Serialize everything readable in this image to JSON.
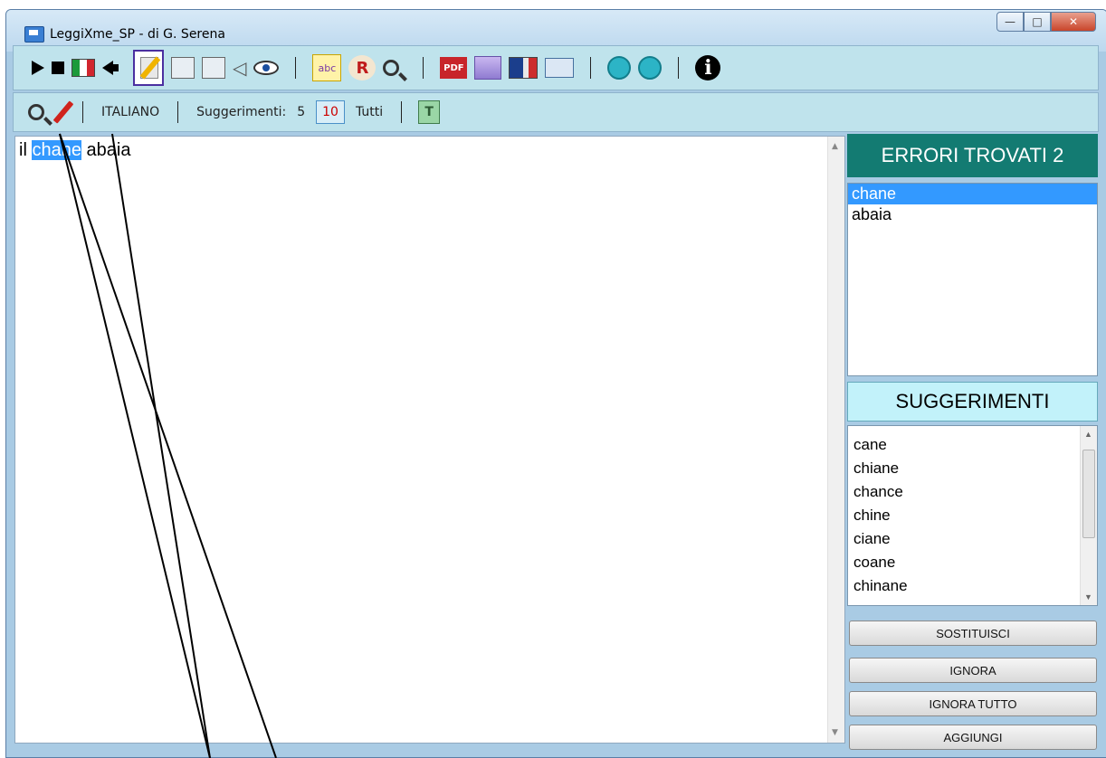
{
  "window": {
    "title": "LeggiXme_SP - di G. Serena"
  },
  "toolbar2": {
    "language": "ITALIANO",
    "suggestions_label": "Suggerimenti:",
    "opt_5": "5",
    "opt_10": "10",
    "opt_all": "Tutti"
  },
  "icons": {
    "pdf_label": "PDF",
    "abc_label": "abc",
    "r_label": "R",
    "t_label": "T",
    "info_label": "i"
  },
  "editor": {
    "before": "il ",
    "highlighted": "chane",
    "after": " abaia"
  },
  "errors": {
    "header": "ERRORI TROVATI 2",
    "items": [
      "chane",
      "abaia"
    ],
    "selected_index": 0
  },
  "suggestions": {
    "header": "SUGGERIMENTI",
    "items": [
      "cane",
      "chiane",
      "chance",
      "chine",
      "ciane",
      "coane",
      "chinane"
    ]
  },
  "actions": {
    "replace": "SOSTITUISCI",
    "ignore": "IGNORA",
    "ignore_all": "IGNORA TUTTO",
    "add": "AGGIUNGI"
  },
  "colors": {
    "errors_header_bg": "#137b72",
    "suggestions_header_bg": "#c2f2fa",
    "selection": "#3399ff",
    "toolbar_bg": "#bfe3ec"
  }
}
